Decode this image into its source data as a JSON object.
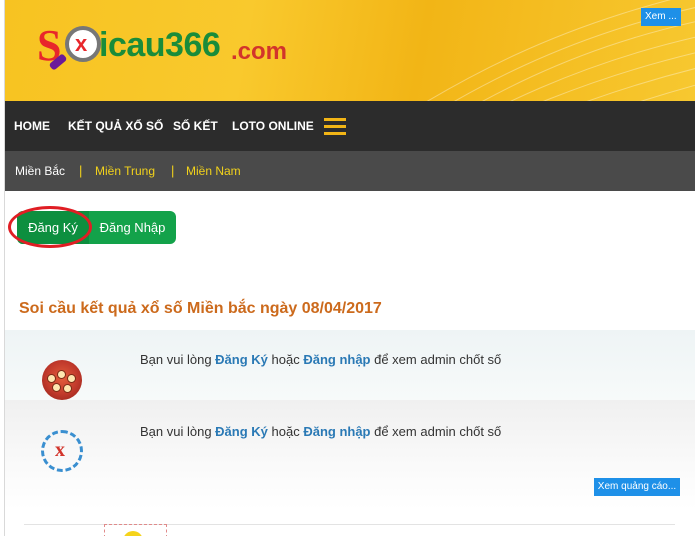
{
  "header": {
    "logo": {
      "s": "S",
      "x": "x",
      "word": "icau366",
      "suffix": ".com"
    },
    "ad_button": "Xem ..."
  },
  "nav": {
    "items": [
      {
        "label": "HOME"
      },
      {
        "label": "KẾT QUẢ XỔ SỐ"
      },
      {
        "label": "SỐ KẾT"
      },
      {
        "label": "LOTO ONLINE"
      }
    ],
    "menu_icon": "hamburger-icon"
  },
  "subnav": {
    "items": [
      {
        "label": "Miền Bắc",
        "color": "#ffffff"
      },
      {
        "label": "Miền Trung",
        "color": "#f2d21b"
      },
      {
        "label": "Miền Nam",
        "color": "#f2d21b"
      }
    ],
    "separator": "|"
  },
  "auth": {
    "register": "Đăng Ký",
    "login": "Đăng Nhập"
  },
  "page_title": "Soi cầu kết quả xổ số Miền bắc ngày 08/04/2017",
  "rows": [
    {
      "prefix": "Bạn vui lòng ",
      "register": "Đăng Ký",
      "middle": " hoặc ",
      "login": "Đăng nhập",
      "suffix": " để xem admin chốt số",
      "icon": "lottery-globe-icon"
    },
    {
      "prefix": "Bạn vui lòng ",
      "register": "Đăng Ký",
      "middle": " hoặc ",
      "login": "Đăng nhập",
      "suffix": " để xem admin chốt số",
      "icon": "swap-x-icon"
    }
  ],
  "ad_button": "Xem quảng cáo...",
  "colors": {
    "accent": "#f2b516",
    "nav_bg": "#2c2c2c",
    "subnav_bg": "#4a4a4a",
    "button_green": "#13a24a",
    "title_orange": "#cc6a1c",
    "link_blue": "#2a79b5",
    "highlight_red": "#e01e24"
  }
}
